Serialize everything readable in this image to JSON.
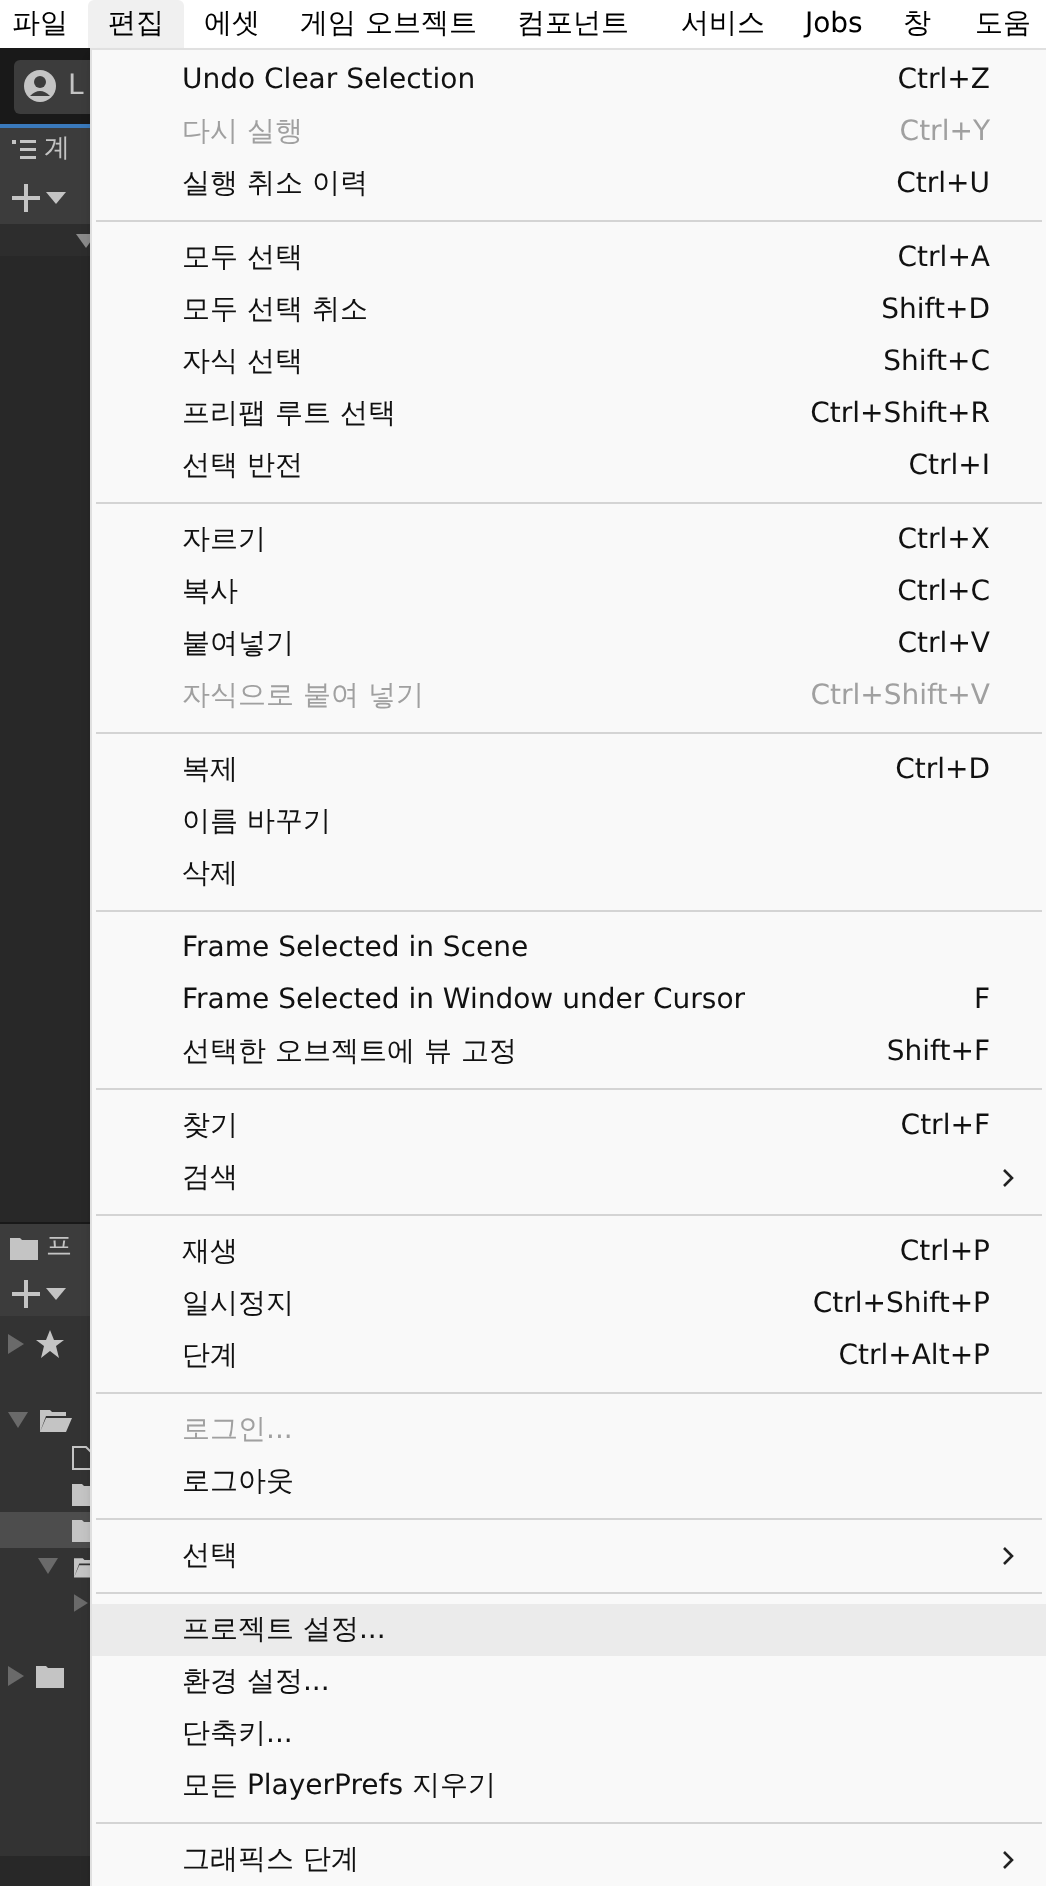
{
  "menu_bar": [
    {
      "label": "파일",
      "selected": false
    },
    {
      "label": "편집",
      "selected": true
    },
    {
      "label": "에셋",
      "selected": false
    },
    {
      "label": "게임 오브젝트",
      "selected": false
    },
    {
      "label": "컴포넌트",
      "selected": false
    },
    {
      "label": "서비스",
      "selected": false
    },
    {
      "label": "Jobs",
      "selected": false
    },
    {
      "label": "창",
      "selected": false
    },
    {
      "label": "도움",
      "selected": false
    }
  ],
  "background": {
    "account_button": "L",
    "hierarchy_tab": "계",
    "project_tab": "프"
  },
  "edit_menu": {
    "groups": [
      {
        "items": [
          {
            "label": "Undo Clear Selection",
            "shortcut": "Ctrl+Z",
            "disabled": false,
            "has_submenu": false,
            "selected": false
          },
          {
            "label": "다시 실행",
            "shortcut": "Ctrl+Y",
            "disabled": true,
            "has_submenu": false,
            "selected": false
          },
          {
            "label": "실행 취소 이력",
            "shortcut": "Ctrl+U",
            "disabled": false,
            "has_submenu": false,
            "selected": false
          }
        ]
      },
      {
        "items": [
          {
            "label": "모두 선택",
            "shortcut": "Ctrl+A",
            "disabled": false,
            "has_submenu": false,
            "selected": false
          },
          {
            "label": "모두 선택 취소",
            "shortcut": "Shift+D",
            "disabled": false,
            "has_submenu": false,
            "selected": false
          },
          {
            "label": "자식 선택",
            "shortcut": "Shift+C",
            "disabled": false,
            "has_submenu": false,
            "selected": false
          },
          {
            "label": "프리팹 루트 선택",
            "shortcut": "Ctrl+Shift+R",
            "disabled": false,
            "has_submenu": false,
            "selected": false
          },
          {
            "label": "선택 반전",
            "shortcut": "Ctrl+I",
            "disabled": false,
            "has_submenu": false,
            "selected": false
          }
        ]
      },
      {
        "items": [
          {
            "label": "자르기",
            "shortcut": "Ctrl+X",
            "disabled": false,
            "has_submenu": false,
            "selected": false
          },
          {
            "label": "복사",
            "shortcut": "Ctrl+C",
            "disabled": false,
            "has_submenu": false,
            "selected": false
          },
          {
            "label": "붙여넣기",
            "shortcut": "Ctrl+V",
            "disabled": false,
            "has_submenu": false,
            "selected": false
          },
          {
            "label": "자식으로 붙여 넣기",
            "shortcut": "Ctrl+Shift+V",
            "disabled": true,
            "has_submenu": false,
            "selected": false
          }
        ]
      },
      {
        "items": [
          {
            "label": "복제",
            "shortcut": "Ctrl+D",
            "disabled": false,
            "has_submenu": false,
            "selected": false
          },
          {
            "label": "이름 바꾸기",
            "disabled": false,
            "has_submenu": false,
            "selected": false
          },
          {
            "label": "삭제",
            "disabled": false,
            "has_submenu": false,
            "selected": false
          }
        ]
      },
      {
        "items": [
          {
            "label": "Frame Selected in Scene",
            "disabled": false,
            "has_submenu": false,
            "selected": false
          },
          {
            "label": "Frame Selected in Window under Cursor",
            "shortcut": "F",
            "disabled": false,
            "has_submenu": false,
            "selected": false
          },
          {
            "label": "선택한 오브젝트에 뷰 고정",
            "shortcut": "Shift+F",
            "disabled": false,
            "has_submenu": false,
            "selected": false
          }
        ]
      },
      {
        "items": [
          {
            "label": "찾기",
            "shortcut": "Ctrl+F",
            "disabled": false,
            "has_submenu": false,
            "selected": false
          },
          {
            "label": "검색",
            "disabled": false,
            "has_submenu": true,
            "selected": false
          }
        ]
      },
      {
        "items": [
          {
            "label": "재생",
            "shortcut": "Ctrl+P",
            "disabled": false,
            "has_submenu": false,
            "selected": false
          },
          {
            "label": "일시정지",
            "shortcut": "Ctrl+Shift+P",
            "disabled": false,
            "has_submenu": false,
            "selected": false
          },
          {
            "label": "단계",
            "shortcut": "Ctrl+Alt+P",
            "disabled": false,
            "has_submenu": false,
            "selected": false
          }
        ]
      },
      {
        "items": [
          {
            "label": "로그인...",
            "disabled": true,
            "has_submenu": false,
            "selected": false
          },
          {
            "label": "로그아웃",
            "disabled": false,
            "has_submenu": false,
            "selected": false
          }
        ]
      },
      {
        "items": [
          {
            "label": "선택",
            "disabled": false,
            "has_submenu": true,
            "selected": false
          }
        ]
      },
      {
        "items": [
          {
            "label": "프로젝트 설정...",
            "disabled": false,
            "has_submenu": false,
            "selected": true
          },
          {
            "label": "환경 설정...",
            "disabled": false,
            "has_submenu": false,
            "selected": false
          },
          {
            "label": "단축키...",
            "disabled": false,
            "has_submenu": false,
            "selected": false
          },
          {
            "label": "모든 PlayerPrefs 지우기",
            "disabled": false,
            "has_submenu": false,
            "selected": false
          }
        ]
      },
      {
        "items": [
          {
            "label": "그래픽스 단계",
            "disabled": false,
            "has_submenu": true,
            "selected": false
          }
        ]
      }
    ]
  }
}
